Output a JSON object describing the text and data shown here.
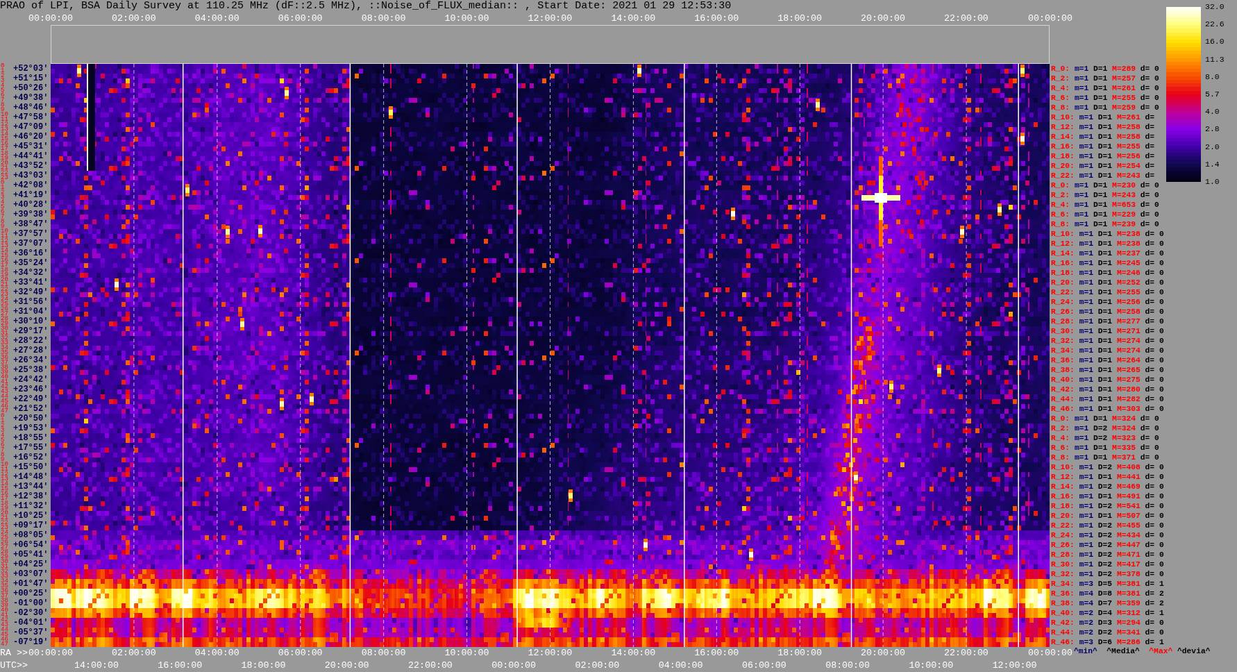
{
  "title": "PRAO of LPI, BSA Daily Survey at 110.25 MHz (dF::2.5 MHz), ::Noise_of_FLUX_median:: , Start Date: 2021 01 29 12:53:30",
  "top_axis": {
    "ticks": [
      "00:00:00",
      "02:00:00",
      "04:00:00",
      "06:00:00",
      "08:00:00",
      "10:00:00",
      "12:00:00",
      "14:00:00",
      "16:00:00",
      "18:00:00",
      "20:00:00",
      "22:00:00",
      "00:00:00"
    ]
  },
  "colorbar": {
    "ticks": [
      "32.0",
      "22.6",
      "16.0",
      "11.3",
      "8.0",
      "5.7",
      "4.0",
      "2.8",
      "2.0",
      "1.4",
      "1.0"
    ]
  },
  "rows": [
    {
      "beams": [
        "0",
        "1"
      ],
      "declination": "+52°03′",
      "label": "R_0:",
      "min": "m=1",
      "median": "D=1",
      "max": "M=289",
      "deviation": "d= 0"
    },
    {
      "beams": [
        "2",
        "3"
      ],
      "declination": "+51°15′",
      "label": "R_2:",
      "min": "m=1",
      "median": "D=1",
      "max": "M=257",
      "deviation": "d= 0"
    },
    {
      "beams": [
        "4",
        "5"
      ],
      "declination": "+50°26′",
      "label": "R_4:",
      "min": "m=1",
      "median": "D=1",
      "max": "M=261",
      "deviation": "d= 0"
    },
    {
      "beams": [
        "6",
        "7"
      ],
      "declination": "+49°38′",
      "label": "R_6:",
      "min": "m=1",
      "median": "D=1",
      "max": "M=255",
      "deviation": "d= 0"
    },
    {
      "beams": [
        "8",
        "9"
      ],
      "declination": "+48°46′",
      "label": "R_8:",
      "min": "m=1",
      "median": "D=1",
      "max": "M=259",
      "deviation": "d= 0"
    },
    {
      "beams": [
        "10",
        "11"
      ],
      "declination": "+47°58′",
      "label": "R_10:",
      "min": "m=1",
      "median": "D=1",
      "max": "M=261",
      "deviation": "d="
    },
    {
      "beams": [
        "12",
        "13"
      ],
      "declination": "+47°09′",
      "label": "R_12:",
      "min": "m=1",
      "median": "D=1",
      "max": "M=258",
      "deviation": "d="
    },
    {
      "beams": [
        "14",
        "15"
      ],
      "declination": "+46°20′",
      "label": "R_14:",
      "min": "m=1",
      "median": "D=1",
      "max": "M=258",
      "deviation": "d="
    },
    {
      "beams": [
        "16",
        "17"
      ],
      "declination": "+45°31′",
      "label": "R_16:",
      "min": "m=1",
      "median": "D=1",
      "max": "M=255",
      "deviation": "d="
    },
    {
      "beams": [
        "18",
        "19"
      ],
      "declination": "+44°41′",
      "label": "R_18:",
      "min": "m=1",
      "median": "D=1",
      "max": "M=256",
      "deviation": "d="
    },
    {
      "beams": [
        "20",
        "21"
      ],
      "declination": "+43°52′",
      "label": "R_20:",
      "min": "m=1",
      "median": "D=1",
      "max": "M=254",
      "deviation": "d="
    },
    {
      "beams": [
        "22",
        "23"
      ],
      "declination": "+43°03′",
      "label": "R_22:",
      "min": "m=1",
      "median": "D=1",
      "max": "M=243",
      "deviation": "d="
    },
    {
      "beams": [
        "0",
        "1"
      ],
      "declination": "+42°08′",
      "label": "R_0:",
      "min": "m=1",
      "median": "D=1",
      "max": "M=230",
      "deviation": "d= 0"
    },
    {
      "beams": [
        "2",
        "3"
      ],
      "declination": "+41°19′",
      "label": "R_2:",
      "min": "m=1",
      "median": "D=1",
      "max": "M=243",
      "deviation": "d= 0"
    },
    {
      "beams": [
        "4",
        "5"
      ],
      "declination": "+40°28′",
      "label": "R_4:",
      "min": "m=1",
      "median": "D=1",
      "max": "M=653",
      "deviation": "d= 0"
    },
    {
      "beams": [
        "6",
        "7"
      ],
      "declination": "+39°38′",
      "label": "R_6:",
      "min": "m=1",
      "median": "D=1",
      "max": "M=229",
      "deviation": "d= 0"
    },
    {
      "beams": [
        "8",
        "9"
      ],
      "declination": "+38°47′",
      "label": "R_8:",
      "min": "m=1",
      "median": "D=1",
      "max": "M=239",
      "deviation": "d= 0"
    },
    {
      "beams": [
        "10",
        "11"
      ],
      "declination": "+37°57′",
      "label": "R_10:",
      "min": "m=1",
      "median": "D=1",
      "max": "M=238",
      "deviation": "d= 0"
    },
    {
      "beams": [
        "12",
        "13"
      ],
      "declination": "+37°07′",
      "label": "R_12:",
      "min": "m=1",
      "median": "D=1",
      "max": "M=238",
      "deviation": "d= 0"
    },
    {
      "beams": [
        "14",
        "15"
      ],
      "declination": "+36°16′",
      "label": "R_14:",
      "min": "m=1",
      "median": "D=1",
      "max": "M=237",
      "deviation": "d= 0"
    },
    {
      "beams": [
        "16",
        "17"
      ],
      "declination": "+35°24′",
      "label": "R_16:",
      "min": "m=1",
      "median": "D=1",
      "max": "M=245",
      "deviation": "d= 0"
    },
    {
      "beams": [
        "18",
        "19"
      ],
      "declination": "+34°32′",
      "label": "R_18:",
      "min": "m=1",
      "median": "D=1",
      "max": "M=246",
      "deviation": "d= 0"
    },
    {
      "beams": [
        "20",
        "21"
      ],
      "declination": "+33°41′",
      "label": "R_20:",
      "min": "m=1",
      "median": "D=1",
      "max": "M=252",
      "deviation": "d= 0"
    },
    {
      "beams": [
        "22",
        "23"
      ],
      "declination": "+32°49′",
      "label": "R_22:",
      "min": "m=1",
      "median": "D=1",
      "max": "M=255",
      "deviation": "d= 0"
    },
    {
      "beams": [
        "24",
        "25"
      ],
      "declination": "+31°56′",
      "label": "R_24:",
      "min": "m=1",
      "median": "D=1",
      "max": "M=256",
      "deviation": "d= 0"
    },
    {
      "beams": [
        "26",
        "27"
      ],
      "declination": "+31°04′",
      "label": "R_26:",
      "min": "m=1",
      "median": "D=1",
      "max": "M=258",
      "deviation": "d= 0"
    },
    {
      "beams": [
        "28",
        "29"
      ],
      "declination": "+30°10′",
      "label": "R_28:",
      "min": "m=1",
      "median": "D=1",
      "max": "M=277",
      "deviation": "d= 0"
    },
    {
      "beams": [
        "30",
        "31"
      ],
      "declination": "+29°17′",
      "label": "R_30:",
      "min": "m=1",
      "median": "D=1",
      "max": "M=271",
      "deviation": "d= 0"
    },
    {
      "beams": [
        "32",
        "33"
      ],
      "declination": "+28°22′",
      "label": "R_32:",
      "min": "m=1",
      "median": "D=1",
      "max": "M=274",
      "deviation": "d= 0"
    },
    {
      "beams": [
        "34",
        "35"
      ],
      "declination": "+27°28′",
      "label": "R_34:",
      "min": "m=1",
      "median": "D=1",
      "max": "M=274",
      "deviation": "d= 0"
    },
    {
      "beams": [
        "36",
        "37"
      ],
      "declination": "+26°34′",
      "label": "R_36:",
      "min": "m=1",
      "median": "D=1",
      "max": "M=264",
      "deviation": "d= 0"
    },
    {
      "beams": [
        "38",
        "39"
      ],
      "declination": "+25°38′",
      "label": "R_38:",
      "min": "m=1",
      "median": "D=1",
      "max": "M=265",
      "deviation": "d= 0"
    },
    {
      "beams": [
        "40",
        "41"
      ],
      "declination": "+24°42′",
      "label": "R_40:",
      "min": "m=1",
      "median": "D=1",
      "max": "M=275",
      "deviation": "d= 0"
    },
    {
      "beams": [
        "42",
        "43"
      ],
      "declination": "+23°46′",
      "label": "R_42:",
      "min": "m=1",
      "median": "D=1",
      "max": "M=280",
      "deviation": "d= 0"
    },
    {
      "beams": [
        "44",
        "45"
      ],
      "declination": "+22°49′",
      "label": "R_44:",
      "min": "m=1",
      "median": "D=1",
      "max": "M=282",
      "deviation": "d= 0"
    },
    {
      "beams": [
        "46",
        "47"
      ],
      "declination": "+21°52′",
      "label": "R_46:",
      "min": "m=1",
      "median": "D=1",
      "max": "M=303",
      "deviation": "d= 0"
    },
    {
      "beams": [
        "0",
        "1"
      ],
      "declination": "+20°50′",
      "label": "R_0:",
      "min": "m=1",
      "median": "D=1",
      "max": "M=324",
      "deviation": "d= 0"
    },
    {
      "beams": [
        "2",
        "3"
      ],
      "declination": "+19°53′",
      "label": "R_2:",
      "min": "m=1",
      "median": "D=2",
      "max": "M=324",
      "deviation": "d= 0"
    },
    {
      "beams": [
        "4",
        "5"
      ],
      "declination": "+18°55′",
      "label": "R_4:",
      "min": "m=1",
      "median": "D=2",
      "max": "M=323",
      "deviation": "d= 0"
    },
    {
      "beams": [
        "6",
        "7"
      ],
      "declination": "+17°55′",
      "label": "R_6:",
      "min": "m=1",
      "median": "D=1",
      "max": "M=335",
      "deviation": "d= 0"
    },
    {
      "beams": [
        "8",
        "9"
      ],
      "declination": "+16°52′",
      "label": "R_8:",
      "min": "m=1",
      "median": "D=1",
      "max": "M=371",
      "deviation": "d= 0"
    },
    {
      "beams": [
        "10",
        "11"
      ],
      "declination": "+15°50′",
      "label": "R_10:",
      "min": "m=1",
      "median": "D=2",
      "max": "M=408",
      "deviation": "d= 0"
    },
    {
      "beams": [
        "12",
        "13"
      ],
      "declination": "+14°48′",
      "label": "R_12:",
      "min": "m=1",
      "median": "D=1",
      "max": "M=441",
      "deviation": "d= 0"
    },
    {
      "beams": [
        "14",
        "15"
      ],
      "declination": "+13°44′",
      "label": "R_14:",
      "min": "m=1",
      "median": "D=2",
      "max": "M=469",
      "deviation": "d= 0"
    },
    {
      "beams": [
        "16",
        "17"
      ],
      "declination": "+12°38′",
      "label": "R_16:",
      "min": "m=1",
      "median": "D=1",
      "max": "M=491",
      "deviation": "d= 0"
    },
    {
      "beams": [
        "18",
        "19"
      ],
      "declination": "+11°32′",
      "label": "R_18:",
      "min": "m=1",
      "median": "D=2",
      "max": "M=541",
      "deviation": "d= 0"
    },
    {
      "beams": [
        "20",
        "21"
      ],
      "declination": "+10°25′",
      "label": "R_20:",
      "min": "m=1",
      "median": "D=1",
      "max": "M=507",
      "deviation": "d= 0"
    },
    {
      "beams": [
        "22",
        "23"
      ],
      "declination": "+09°17′",
      "label": "R_22:",
      "min": "m=1",
      "median": "D=2",
      "max": "M=455",
      "deviation": "d= 0"
    },
    {
      "beams": [
        "24",
        "25"
      ],
      "declination": "+08°05′",
      "label": "R_24:",
      "min": "m=1",
      "median": "D=2",
      "max": "M=434",
      "deviation": "d= 0"
    },
    {
      "beams": [
        "26",
        "27"
      ],
      "declination": "+06°54′",
      "label": "R_26:",
      "min": "m=1",
      "median": "D=2",
      "max": "M=447",
      "deviation": "d= 0"
    },
    {
      "beams": [
        "28",
        "29"
      ],
      "declination": "+05°41′",
      "label": "R_28:",
      "min": "m=1",
      "median": "D=2",
      "max": "M=471",
      "deviation": "d= 0"
    },
    {
      "beams": [
        "30",
        "31"
      ],
      "declination": "+04°25′",
      "label": "R_30:",
      "min": "m=1",
      "median": "D=2",
      "max": "M=417",
      "deviation": "d= 0"
    },
    {
      "beams": [
        "32",
        "33"
      ],
      "declination": "+03°07′",
      "label": "R_32:",
      "min": "m=1",
      "median": "D=2",
      "max": "M=378",
      "deviation": "d= 0"
    },
    {
      "beams": [
        "34",
        "35"
      ],
      "declination": "+01°47′",
      "label": "R_34:",
      "min": "m=3",
      "median": "D=5",
      "max": "M=381",
      "deviation": "d= 1"
    },
    {
      "beams": [
        "36",
        "37"
      ],
      "declination": "+00°25′",
      "label": "R_36:",
      "min": "m=4",
      "median": "D=8",
      "max": "M=381",
      "deviation": "d= 2"
    },
    {
      "beams": [
        "38",
        "39"
      ],
      "declination": "-01°00′",
      "label": "R_38:",
      "min": "m=4",
      "median": "D=7",
      "max": "M=359",
      "deviation": "d= 2"
    },
    {
      "beams": [
        "40",
        "41"
      ],
      "declination": "-02°30′",
      "label": "R_40:",
      "min": "m=2",
      "median": "D=4",
      "max": "M=312",
      "deviation": "d= 1"
    },
    {
      "beams": [
        "42",
        "43"
      ],
      "declination": "-04°01′",
      "label": "R_42:",
      "min": "m=2",
      "median": "D=3",
      "max": "M=294",
      "deviation": "d= 0"
    },
    {
      "beams": [
        "44",
        "45"
      ],
      "declination": "-05°37′",
      "label": "R_44:",
      "min": "m=2",
      "median": "D=2",
      "max": "M=341",
      "deviation": "d= 0"
    },
    {
      "beams": [
        "46",
        "47"
      ],
      "declination": "-07°19′",
      "label": "R_46:",
      "min": "m=3",
      "median": "D=6",
      "max": "M=286",
      "deviation": "d= 1"
    }
  ],
  "legend": {
    "min": "^min^",
    "median": "^Media^",
    "max": "^Max^",
    "deviation": "^devia^"
  },
  "ra_axis": {
    "label": "RA >>",
    "ticks": [
      "00:00:00",
      "02:00:00",
      "04:00:00",
      "06:00:00",
      "08:00:00",
      "10:00:00",
      "12:00:00",
      "14:00:00",
      "16:00:00",
      "18:00:00",
      "20:00:00",
      "22:00:00",
      "00:00:00"
    ]
  },
  "utc_axis": {
    "label": "UTC>>",
    "ticks": [
      "14:00:00",
      "16:00:00",
      "18:00:00",
      "20:00:00",
      "22:00:00",
      "00:00:00",
      "02:00:00",
      "04:00:00",
      "06:00:00",
      "08:00:00",
      "10:00:00",
      "12:00:00"
    ]
  }
}
